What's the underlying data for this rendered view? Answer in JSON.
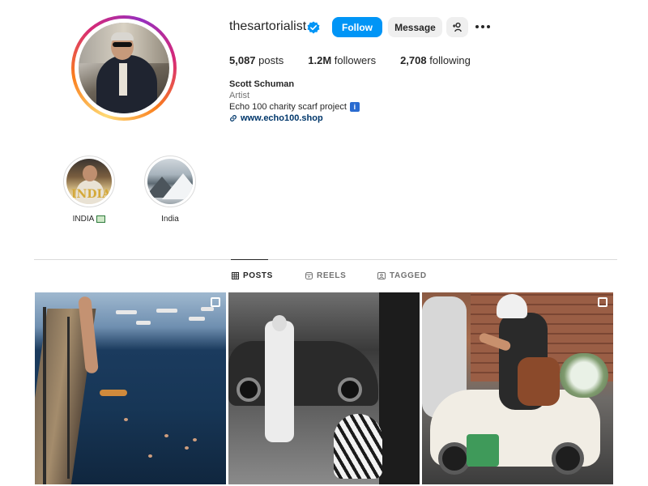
{
  "profile": {
    "username": "thesartorialist",
    "verified": true,
    "follow_label": "Follow",
    "message_label": "Message",
    "posts_count": "5,087",
    "posts_label": "posts",
    "followers_count": "1.2M",
    "followers_label": "followers",
    "following_count": "2,708",
    "following_label": "following",
    "full_name": "Scott Schuman",
    "category": "Artist",
    "bio": "Echo 100 charity scarf project",
    "bio_emoji": "i",
    "link": "www.echo100.shop"
  },
  "highlights": [
    {
      "label": "INDIA",
      "image_text": "INDIA"
    },
    {
      "label": "India"
    }
  ],
  "tabs": [
    {
      "label": "POSTS",
      "icon": "grid-icon",
      "active": true
    },
    {
      "label": "REELS",
      "icon": "reels-icon",
      "active": false
    },
    {
      "label": "TAGGED",
      "icon": "tagged-icon",
      "active": false
    }
  ],
  "posts": [
    {
      "multi": true
    },
    {
      "multi": false
    },
    {
      "multi": true
    }
  ],
  "colors": {
    "accent": "#0095f6",
    "secondary_button": "#efefef",
    "link": "#00376b",
    "muted": "#737373"
  }
}
